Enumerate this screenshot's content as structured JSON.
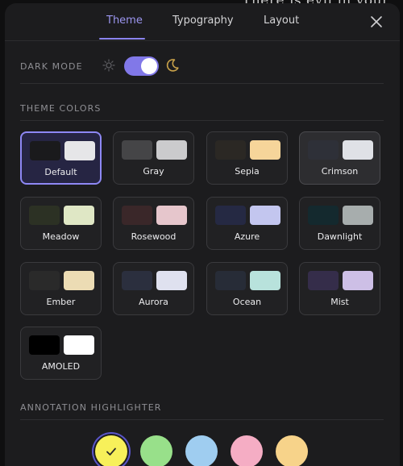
{
  "background": {
    "text": "There is evil in your"
  },
  "tabs": [
    {
      "label": "Theme",
      "active": true
    },
    {
      "label": "Typography",
      "active": false
    },
    {
      "label": "Layout",
      "active": false
    }
  ],
  "dark_mode": {
    "label": "DARK MODE",
    "enabled": true
  },
  "theme_colors": {
    "label": "THEME COLORS",
    "selected": "Default",
    "items": [
      {
        "label": "Default",
        "dark": "#1a1a1c",
        "light": "#e6e6e8"
      },
      {
        "label": "Gray",
        "dark": "#454547",
        "light": "#cbcbcd"
      },
      {
        "label": "Sepia",
        "dark": "#2b2824",
        "light": "#f6d59a"
      },
      {
        "label": "Crimson",
        "dark": "#2e3038",
        "light": "#dfe1e6"
      },
      {
        "label": "Meadow",
        "dark": "#2c3124",
        "light": "#dfe7c5"
      },
      {
        "label": "Rosewood",
        "dark": "#3a2729",
        "light": "#e6c6cc"
      },
      {
        "label": "Azure",
        "dark": "#252943",
        "light": "#c3c6ef"
      },
      {
        "label": "Dawnlight",
        "dark": "#14292e",
        "light": "#a7adad"
      },
      {
        "label": "Ember",
        "dark": "#2a2a2a",
        "light": "#ecdcb4"
      },
      {
        "label": "Aurora",
        "dark": "#2b2f3e",
        "light": "#dfe1ef"
      },
      {
        "label": "Ocean",
        "dark": "#272c37",
        "light": "#b8e2dc"
      },
      {
        "label": "Mist",
        "dark": "#352d4a",
        "light": "#cdbfe6"
      },
      {
        "label": "AMOLED",
        "dark": "#000000",
        "light": "#ffffff"
      }
    ]
  },
  "annotation_highlighter": {
    "label": "ANNOTATION HIGHLIGHTER",
    "colors": [
      "#f7f05a",
      "#98e08a",
      "#9fcdf0",
      "#f5adc4",
      "#f7d38a"
    ],
    "selected_index": 0
  }
}
